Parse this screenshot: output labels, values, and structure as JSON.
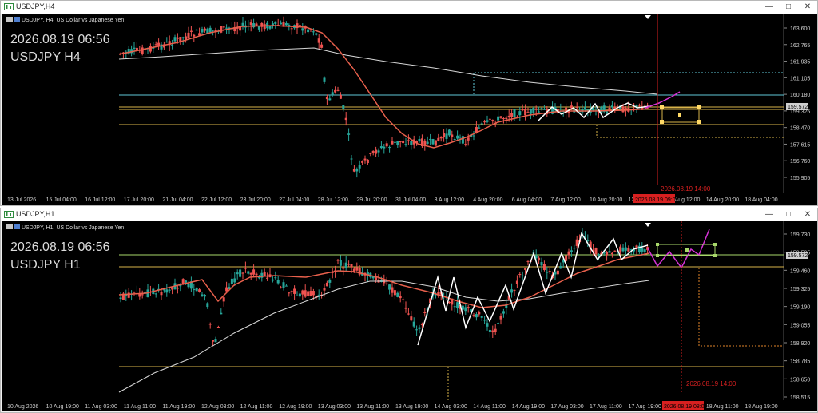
{
  "windows": [
    {
      "title": "USDJPY,H4",
      "symbol_line": "USDJPY, H4:  US Dollar vs Japanese Yen",
      "overlay_datetime": "2026.08.19 06:56",
      "overlay_symbol": "USDJPY H4",
      "price_labels": [
        "163.600",
        "162.765",
        "161.935",
        "161.105",
        "160.180",
        "159.325",
        "158.470",
        "157.615",
        "156.760",
        "155.905"
      ],
      "current_price_tag": "159.572",
      "time_labels": [
        "13 Jul 2026",
        "15 Jul 04:00",
        "16 Jul 12:00",
        "17 Jul 20:00",
        "21 Jul 04:00",
        "22 Jul 12:00",
        "23 Jul 20:00",
        "27 Jul 04:00",
        "28 Jul 12:00",
        "29 Jul 20:00",
        "31 Jul 04:00",
        "3 Aug 12:00",
        "4 Aug 20:00",
        "6 Aug 04:00",
        "7 Aug 12:00",
        "10 Aug 20:00",
        "12 Aug 04:00",
        "13 Aug 12:00",
        "14 Aug 20:00",
        "18 Aug 04:00"
      ],
      "cursor_time_tag": "2026.08.19 09:00",
      "vline_label": "2026.08.19 14:00"
    },
    {
      "title": "USDJPY,H1",
      "symbol_line": "USDJPY, H1:  US Dollar vs Japanese Yen",
      "overlay_datetime": "2026.08.19 06:56",
      "overlay_symbol": "USDJPY H1",
      "price_labels": [
        "159.730",
        "159.595",
        "159.460",
        "159.325",
        "159.190",
        "159.055",
        "158.920",
        "158.785",
        "158.650",
        "158.515"
      ],
      "current_price_tag": "159.572",
      "current_price_tag2": "159.625",
      "time_labels": [
        "10 Aug 2026",
        "10 Aug 19:00",
        "11 Aug 03:00",
        "11 Aug 11:00",
        "11 Aug 19:00",
        "12 Aug 03:00",
        "12 Aug 11:00",
        "12 Aug 19:00",
        "13 Aug 03:00",
        "13 Aug 11:00",
        "13 Aug 19:00",
        "14 Aug 03:00",
        "14 Aug 11:00",
        "14 Aug 19:00",
        "17 Aug 03:00",
        "17 Aug 11:00",
        "17 Aug 19:00",
        "18 Aug 03:00",
        "18 Aug 11:00",
        "18 Aug 19:00"
      ],
      "cursor_time_tag": "2026.08.19 08:00",
      "vline_label": "2026.08.19 14:00"
    }
  ],
  "colors": {
    "bull": "#26a69a",
    "bear": "#ef5350",
    "ma_fast": "#e8604c",
    "ma_slow": "#d8d8d8",
    "zigzag": "#ffffff",
    "projection": "#d633d6",
    "hline_cyan": "#5fc7d8",
    "hline_gold": "#d9b34a",
    "hline_green": "#a8d86a",
    "vline": "#d82020"
  }
}
